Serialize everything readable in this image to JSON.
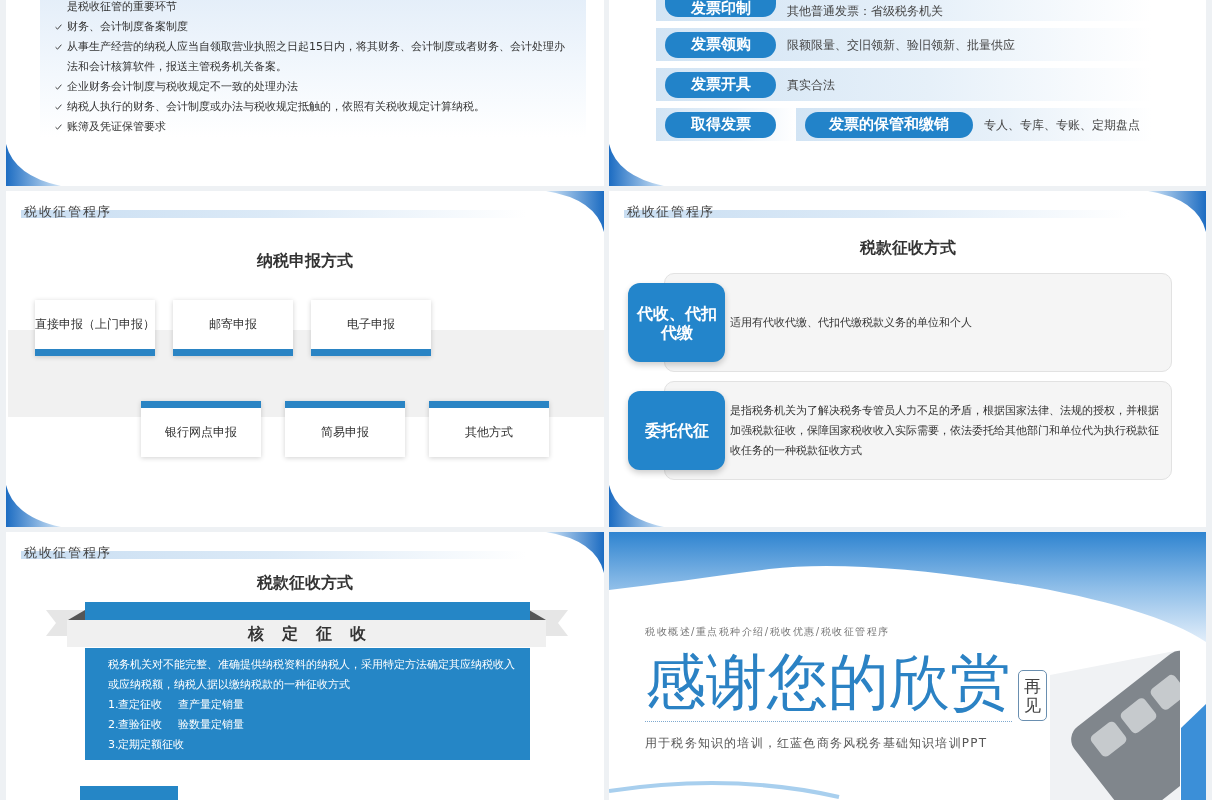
{
  "slides": [
    {
      "kind": "checklist",
      "items": [
        {
          "kind": "continuation",
          "text": "是税收征管的重要环节"
        },
        {
          "kind": "check",
          "text": "财务、会计制度备案制度"
        },
        {
          "kind": "check",
          "text": "从事生产经营的纳税人应当自领取营业执照之日起15日内，将其财务、会计制度或者财务、会计处理办法和会计核算软件，报送主管税务机关备案。"
        },
        {
          "kind": "check",
          "text": "企业财务会计制度与税收规定不一致的处理办法"
        },
        {
          "kind": "check",
          "text": "纳税人执行的财务、会计制度或办法与税收规定抵触的，依照有关税收规定计算纳税。"
        },
        {
          "kind": "check",
          "text": "账簿及凭证保管要求"
        }
      ]
    },
    {
      "kind": "invoice_flow",
      "rows": [
        {
          "stages": [
            {
              "label": "发票印制",
              "lines": [
                "其他普通发票：省级税务机关"
              ]
            }
          ]
        },
        {
          "stages": [
            {
              "label": "发票领购",
              "lines": [
                "限额限量、交旧领新、验旧领新、批量供应"
              ]
            }
          ]
        },
        {
          "stages": [
            {
              "label": "发票开具",
              "lines": [
                "真实合法"
              ]
            }
          ]
        },
        {
          "stages": [
            {
              "label": "取得发票"
            },
            {
              "label": "发票的保管和缴销",
              "lines": [
                "专人、专库、专账、定期盘点"
              ]
            }
          ]
        }
      ]
    },
    {
      "kind": "filing_methods",
      "header": "税收征管程序",
      "title": "纳税申报方式",
      "top_cards": [
        "直接申报（上门申报）",
        "邮寄申报",
        "电子申报"
      ],
      "bottom_cards": [
        "银行网点申报",
        "简易申报",
        "其他方式"
      ]
    },
    {
      "kind": "collection_methods",
      "header": "税收征管程序",
      "title": "税款征收方式",
      "cards": [
        {
          "label": "代收、代扣代缴",
          "description": "适用有代收代缴、代扣代缴税款义务的单位和个人"
        },
        {
          "label": "委托代征",
          "description": "是指税务机关为了解决税务专管员人力不足的矛盾，根据国家法律、法规的授权，并根据加强税款征收，保障国家税收收入实际需要，依法委托给其他部门和单位代为执行税款征收任务的一种税款征收方式"
        }
      ]
    },
    {
      "kind": "assessed_collection",
      "header": "税收征管程序",
      "title": "税款征收方式",
      "banner": "核定征收",
      "intro": "税务机关对不能完整、准确提供纳税资料的纳税人，采用特定方法确定其应纳税收入或应纳税额，纳税人据以缴纳税款的一种征收方式",
      "methods": [
        {
          "label": "1.查定征收",
          "detail": "查产量定销量"
        },
        {
          "label": "2.查验征收",
          "detail": "验数量定销量"
        },
        {
          "label": "3.定期定额征收"
        }
      ]
    },
    {
      "kind": "closing",
      "nav": "税收概述/重点税种介绍/税收优惠/税收征管程序",
      "headline": "感谢您的欣赏",
      "tag": "再见",
      "subtitle": "用于税务知识的培训，红蓝色商务风税务基础知识培训PPT"
    }
  ]
}
